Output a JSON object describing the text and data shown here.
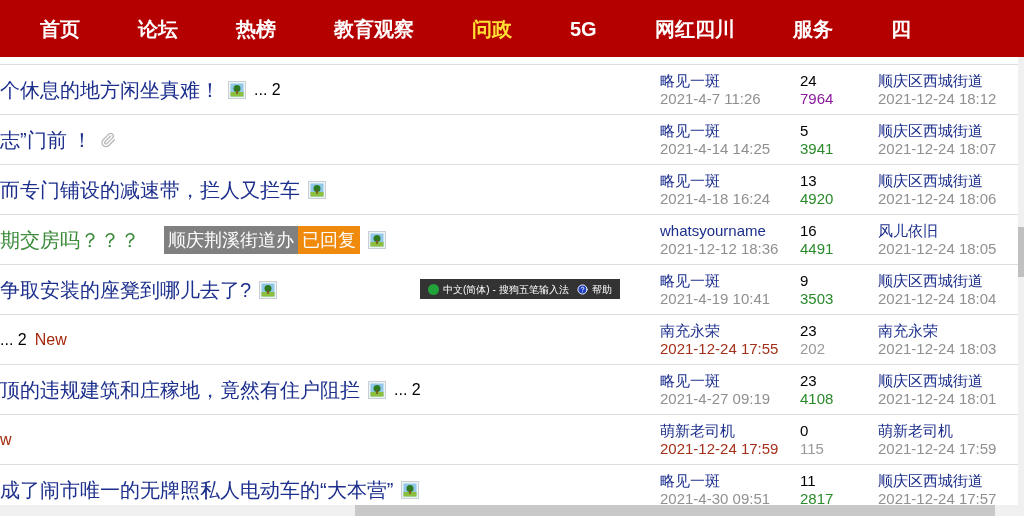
{
  "nav": [
    {
      "label": "首页",
      "selected": false
    },
    {
      "label": "论坛",
      "selected": false
    },
    {
      "label": "热榜",
      "selected": false
    },
    {
      "label": "教育观察",
      "selected": false
    },
    {
      "label": "问政",
      "selected": true
    },
    {
      "label": "5G",
      "selected": false
    },
    {
      "label": "网红四川",
      "selected": false
    },
    {
      "label": "服务",
      "selected": false
    },
    {
      "label": "四",
      "selected": false
    }
  ],
  "threads": [
    {
      "title_parts": [
        {
          "kind": "title",
          "text": "个休息的地方闲坐真难！",
          "color": "#1c2f8c"
        },
        {
          "kind": "image"
        },
        {
          "kind": "pages",
          "text": "... 2"
        }
      ],
      "author": "略见一斑",
      "posted": "2021-4-7 11:26",
      "new": false,
      "replies": "24",
      "views": {
        "text": "7964",
        "color": "#8b1a9c"
      },
      "last_user": "顺庆区西城街道",
      "last_time": "2021-12-24 18:12"
    },
    {
      "title_parts": [
        {
          "kind": "title",
          "text": "志”门前 ！",
          "color": "#1c2f8c"
        },
        {
          "kind": "attachment"
        }
      ],
      "author": "略见一斑",
      "posted": "2021-4-14 14:25",
      "new": false,
      "replies": "5",
      "views": {
        "text": "3941",
        "color": "#2a8a2a"
      },
      "last_user": "顺庆区西城街道",
      "last_time": "2021-12-24 18:07"
    },
    {
      "title_parts": [
        {
          "kind": "title",
          "text": "而专门铺设的减速带，拦人又拦车",
          "color": "#1c2f8c"
        },
        {
          "kind": "image"
        }
      ],
      "author": "略见一斑",
      "posted": "2021-4-18 16:24",
      "new": false,
      "replies": "13",
      "views": {
        "text": "4920",
        "color": "#2a8a2a"
      },
      "last_user": "顺庆区西城街道",
      "last_time": "2021-12-24 18:06"
    },
    {
      "title_parts": [
        {
          "kind": "title",
          "text": "期交房吗？？？",
          "color": "#3a8a3a"
        },
        {
          "kind": "tag",
          "label": "顺庆荆溪街道办",
          "status": "已回复"
        },
        {
          "kind": "image"
        }
      ],
      "author": "whatsyourname",
      "posted": "2021-12-12 18:36",
      "new": false,
      "replies": "16",
      "views": {
        "text": "4491",
        "color": "#2a8a2a"
      },
      "last_user": "风儿依旧",
      "last_time": "2021-12-24 18:05"
    },
    {
      "title_parts": [
        {
          "kind": "title",
          "text": "争取安装的座凳到哪儿去了?",
          "color": "#1c2f8c"
        },
        {
          "kind": "image"
        }
      ],
      "author": "略见一斑",
      "posted": "2021-4-19 10:41",
      "new": false,
      "replies": "9",
      "views": {
        "text": "3503",
        "color": "#2a8a2a"
      },
      "last_user": "顺庆区西城街道",
      "last_time": "2021-12-24 18:04",
      "ime": {
        "text": "中文(简体) - 搜狗五笔输入法",
        "help": "帮助"
      }
    },
    {
      "title_parts": [
        {
          "kind": "pages",
          "text": "... 2"
        },
        {
          "kind": "new",
          "text": "New"
        }
      ],
      "author": "南充永荣",
      "posted": "2021-12-24 17:55",
      "new": true,
      "replies": "23",
      "views": {
        "text": "202",
        "color": "#999999"
      },
      "last_user": "南充永荣",
      "last_time": "2021-12-24 18:03"
    },
    {
      "title_parts": [
        {
          "kind": "title",
          "text": "顶的违规建筑和庄稼地，竟然有住户阻拦",
          "color": "#1c2f8c"
        },
        {
          "kind": "image"
        },
        {
          "kind": "pages",
          "text": "... 2"
        }
      ],
      "author": "略见一斑",
      "posted": "2021-4-27 09:19",
      "new": false,
      "replies": "23",
      "views": {
        "text": "4108",
        "color": "#2a8a2a"
      },
      "last_user": "顺庆区西城街道",
      "last_time": "2021-12-24 18:01"
    },
    {
      "title_parts": [
        {
          "kind": "new",
          "text": "w"
        }
      ],
      "author": "萌新老司机",
      "posted": "2021-12-24 17:59",
      "new": true,
      "replies": "0",
      "views": {
        "text": "115",
        "color": "#999999"
      },
      "last_user": "萌新老司机",
      "last_time": "2021-12-24 17:59"
    },
    {
      "title_parts": [
        {
          "kind": "title",
          "text": "成了闹市唯一的无牌照私人电动车的“大本营”",
          "color": "#1c2f8c"
        },
        {
          "kind": "image"
        }
      ],
      "author": "略见一斑",
      "posted": "2021-4-30 09:51",
      "new": false,
      "replies": "11",
      "views": {
        "text": "2817",
        "color": "#2a8a2a"
      },
      "last_user": "顺庆区西城街道",
      "last_time": "2021-12-24 17:57"
    }
  ]
}
